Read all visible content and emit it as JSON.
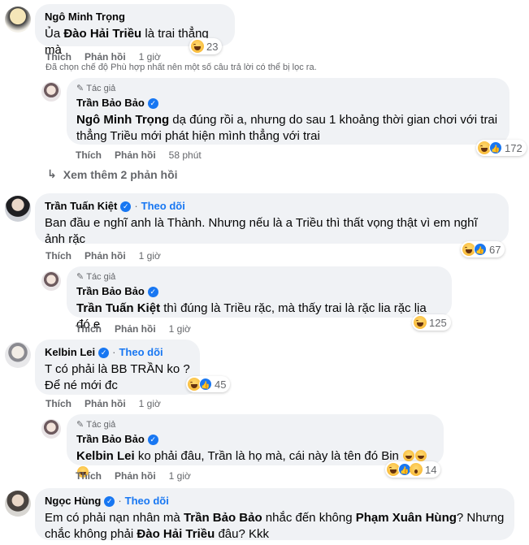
{
  "comments": [
    {
      "name": "Ngô Minh Trọng",
      "text_prefix": "Ủa ",
      "text_mention": "Đào Hải Triều",
      "text_suffix": " là trai thẳng mà",
      "actions": [
        "Thích",
        "Phản hồi"
      ],
      "time": "1 giờ",
      "reaction_count": "23",
      "avatar_colors": [
        "#f5e6b8",
        "#3a3a3a"
      ]
    },
    {
      "author_tag": "Tác giả",
      "name": "Trần Bảo Bảo",
      "text_mention": "Ngô Minh Trọng",
      "text_suffix": " dạ đúng rồi a, nhưng do sau 1 khoảng thời gian chơi với trai thẳng Triều mới phát hiện mình thẳng với trai",
      "actions": [
        "Thích",
        "Phản hồi"
      ],
      "time": "58 phút",
      "reaction_count": "172",
      "avatar_colors": [
        "#e9e4e6",
        "#6d5a5e"
      ]
    },
    {
      "name": "Trần Tuấn Kiệt",
      "follow": "Theo dõi",
      "text": "Ban đầu e nghĩ anh là Thành. Nhưng nếu là a Triều thì thất vọng thật vì em nghĩ ảnh rặc",
      "actions": [
        "Thích",
        "Phản hồi"
      ],
      "time": "1 giờ",
      "reaction_count": "67",
      "avatar_colors": [
        "#cfd2d8",
        "#1f1f22"
      ]
    },
    {
      "author_tag": "Tác giả",
      "name": "Trần Bảo Bảo",
      "text_mention": "Trần Tuấn Kiệt",
      "text_suffix": " thì đúng là Triều rặc, mà thấy trai là rặc lia rặc lịa đó e",
      "actions": [
        "Thích",
        "Phản hồi"
      ],
      "time": "1 giờ",
      "reaction_count": "125",
      "avatar_colors": [
        "#e9e4e6",
        "#6d5a5e"
      ]
    },
    {
      "name": "Kelbin Lei",
      "follow": "Theo dõi",
      "line1": "T có phải là BB TRẦN ko ?",
      "line2": "Để né mới đc",
      "actions": [
        "Thích",
        "Phản hồi"
      ],
      "time": "1 giờ",
      "reaction_count": "45",
      "avatar_colors": [
        "#e8e8ea",
        "#8a8a90"
      ]
    },
    {
      "author_tag": "Tác giả",
      "name": "Trần Bảo Bảo",
      "text_mention": "Kelbin Lei",
      "text_suffix": " ko phải đâu, Trần là họ mà, cái này là tên đó Bin",
      "actions": [
        "Thích",
        "Phản hồi"
      ],
      "time": "1 giờ",
      "reaction_count": "14",
      "avatar_colors": [
        "#e9e4e6",
        "#6d5a5e"
      ]
    },
    {
      "name": "Ngọc Hùng",
      "follow": "Theo dõi",
      "text_prefix": "Em có phải nạn nhân mà ",
      "text_mention1": "Trần Bảo Bảo",
      "text_mid1": " nhắc đến không ",
      "text_mention2": "Phạm Xuân Hùng",
      "text_mid2": "? Nhưng chắc không phải ",
      "text_mention3": "Đào Hải Triều",
      "text_suffix": " đâu? Kkk",
      "avatar_colors": [
        "#d8d6d2",
        "#4a4440"
      ]
    }
  ],
  "filter_notice": "Đã chọn chế độ Phù hợp nhất nên một số câu trả lời có thể bị lọc ra.",
  "view_more": "Xem thêm 2 phản hồi",
  "icons": {
    "verified": "verified-badge-icon",
    "author": "pencil-icon",
    "view_more": "reply-arrow-icon",
    "reactions": [
      "haha-reaction-icon",
      "like-reaction-icon",
      "wow-reaction-icon"
    ]
  },
  "colors": {
    "accent": "#1877f2",
    "bubble": "#f0f2f5",
    "secondary_text": "#65676b"
  }
}
